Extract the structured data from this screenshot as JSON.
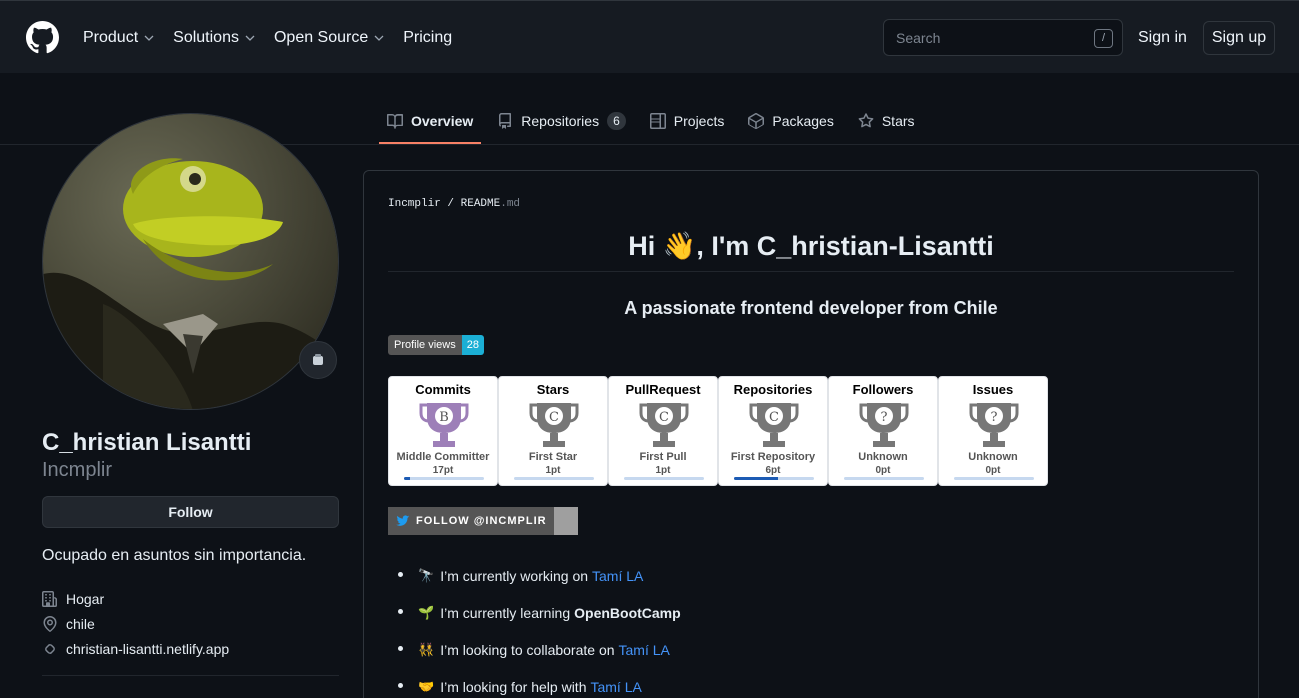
{
  "header": {
    "nav": [
      "Product",
      "Solutions",
      "Open Source",
      "Pricing"
    ],
    "search_placeholder": "Search",
    "search_shortcut": "/",
    "signin": "Sign in",
    "signup": "Sign up"
  },
  "tabs": [
    {
      "label": "Overview",
      "icon": "book-icon"
    },
    {
      "label": "Repositories",
      "icon": "repo-icon",
      "count": "6"
    },
    {
      "label": "Projects",
      "icon": "project-icon"
    },
    {
      "label": "Packages",
      "icon": "package-icon"
    },
    {
      "label": "Stars",
      "icon": "star-icon"
    }
  ],
  "profile": {
    "name": "C_hristian Lisantti",
    "login": "Incmplir",
    "follow_label": "Follow",
    "bio": "Ocupado en asuntos sin importancia.",
    "company": "Hogar",
    "location": "chile",
    "website": "christian-lisantti.netlify.app"
  },
  "readme": {
    "owner": "Incmplir",
    "file": "README",
    "ext": ".md",
    "title": "Hi 👋, I'm C_hristian-Lisantti",
    "subtitle": "A passionate frontend developer from Chile",
    "views_label": "Profile views",
    "views_count": "28",
    "trophies": [
      {
        "title": "Commits",
        "rank": "B",
        "label": "Middle Committer",
        "points": "17pt",
        "progress": 0.08,
        "color": "#9d7fb8"
      },
      {
        "title": "Stars",
        "rank": "C",
        "label": "First Star",
        "points": "1pt",
        "progress": 0.0,
        "color": "#777777"
      },
      {
        "title": "PullRequest",
        "rank": "C",
        "label": "First Pull",
        "points": "1pt",
        "progress": 0.0,
        "color": "#777777"
      },
      {
        "title": "Repositories",
        "rank": "C",
        "label": "First Repository",
        "points": "6pt",
        "progress": 0.55,
        "color": "#777777"
      },
      {
        "title": "Followers",
        "rank": "?",
        "label": "Unknown",
        "points": "0pt",
        "progress": 0.0,
        "color": "#777777"
      },
      {
        "title": "Issues",
        "rank": "?",
        "label": "Unknown",
        "points": "0pt",
        "progress": 0.0,
        "color": "#777777"
      }
    ],
    "twitter_label": "FOLLOW @INCMPLIR",
    "items": [
      {
        "emoji": "🔭",
        "text": "I’m currently working on",
        "link": "Tamí LA"
      },
      {
        "emoji": "🌱",
        "text": "I’m currently learning",
        "bold": "OpenBootCamp"
      },
      {
        "emoji": "👯",
        "text": "I’m looking to collaborate on",
        "link": "Tamí LA"
      },
      {
        "emoji": "🤝",
        "text": "I’m looking for help with",
        "link": "Tamí LA"
      }
    ]
  },
  "colors": {
    "accent": "#f78166",
    "link": "#4493f8",
    "bg": "#0d1117"
  }
}
